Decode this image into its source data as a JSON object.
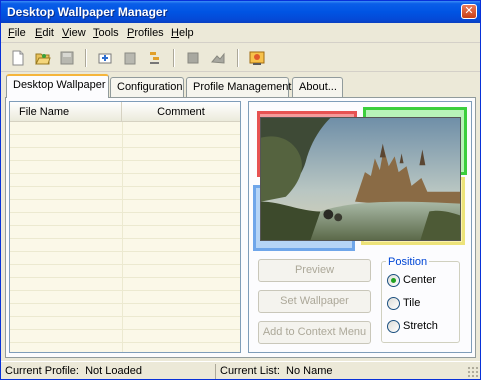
{
  "window": {
    "title": "Desktop Wallpaper Manager",
    "close_glyph": "✕"
  },
  "menu": [
    {
      "key": "F",
      "rest": "ile"
    },
    {
      "key": "E",
      "rest": "dit"
    },
    {
      "key": "V",
      "rest": "iew"
    },
    {
      "key": "T",
      "rest": "ools"
    },
    {
      "key": "P",
      "rest": "rofiles"
    },
    {
      "key": "H",
      "rest": "elp"
    }
  ],
  "toolbar": {
    "icons": [
      "new-file-icon",
      "open-folder-icon",
      "save-icon",
      "import-icon",
      "delete-icon",
      "sort-icon",
      "move-up-icon",
      "move-down-icon",
      "wallpaper-app-icon"
    ]
  },
  "tabs": [
    "Desktop Wallpaper",
    "Configuration",
    "Profile Management",
    "About..."
  ],
  "file_list": {
    "col_name": "File Name",
    "col_comment": "Comment"
  },
  "buttons": {
    "preview": "Preview",
    "set_wallpaper": "Set Wallpaper",
    "add_context": "Add to Context Menu"
  },
  "position": {
    "title": "Position",
    "options": [
      "Center",
      "Tile",
      "Stretch"
    ],
    "selected": "Center"
  },
  "status": {
    "profile_label": "Current Profile:",
    "profile_value": "Not Loaded",
    "list_label": "Current List:",
    "list_value": "No Name"
  },
  "colors": {
    "title_bar": "#0054e3",
    "tab_highlight": "#f5b53c",
    "group_title": "#0046d5"
  }
}
